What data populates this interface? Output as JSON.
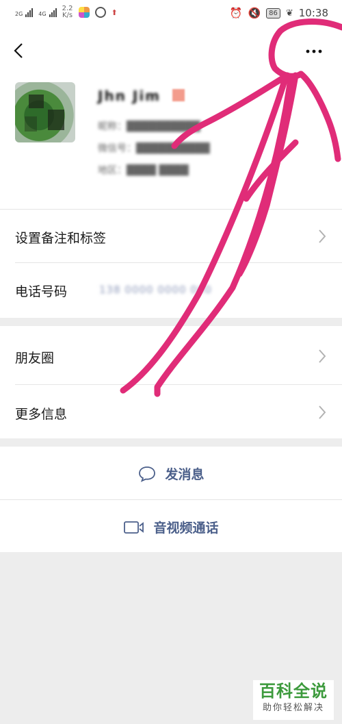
{
  "status_bar": {
    "network_1": "2G",
    "network_2": "4G",
    "speed_value": "2.2",
    "speed_unit": "K/s",
    "battery": "86",
    "time": "10:38"
  },
  "profile": {
    "name_blurred": "Jhn  Jim",
    "line1_blurred": "昵称：██████████",
    "line2_blurred": "微信号：██████████",
    "line3_blurred": "地区：████ ████"
  },
  "menu": {
    "set_remark_label": "设置备注和标签",
    "phone_label": "电话号码",
    "phone_value_blurred": "138 0000 0000 000",
    "moments_label": "朋友圈",
    "more_info_label": "更多信息"
  },
  "actions": {
    "send_message_label": "发消息",
    "av_call_label": "音视频通话"
  },
  "watermark": {
    "title": "百科全说",
    "subtitle": "助你轻松解决"
  },
  "colors": {
    "accent_link": "#4b5f8a",
    "annotation": "#e02c78",
    "watermark_green": "#3c9a3c"
  }
}
